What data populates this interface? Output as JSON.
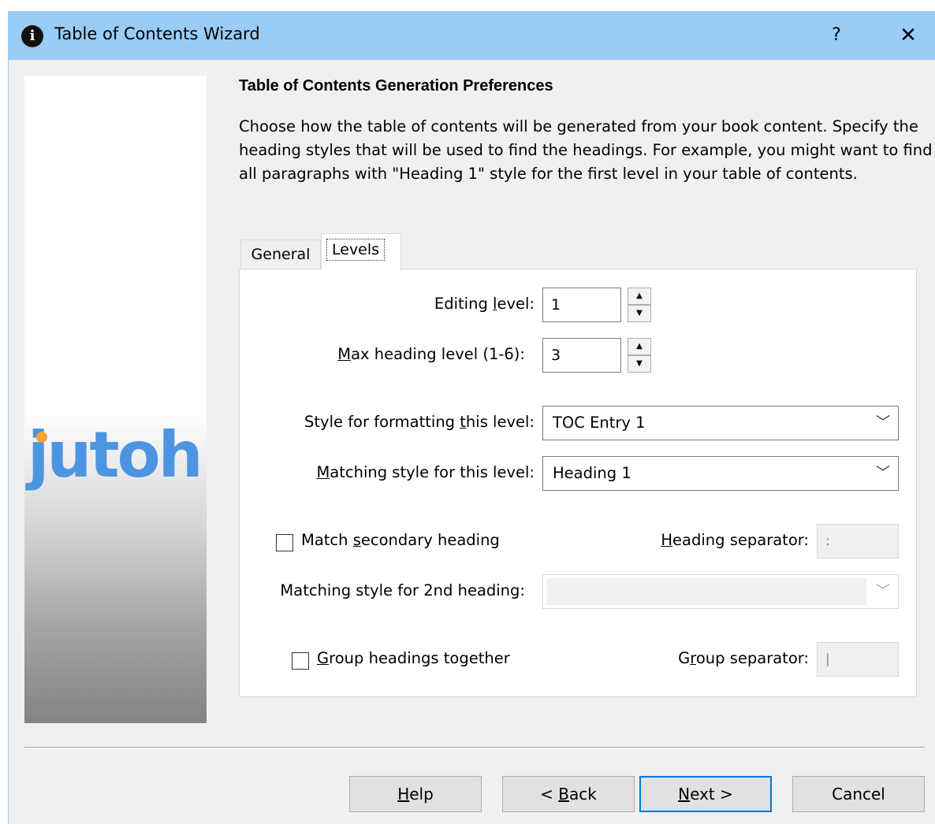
{
  "window": {
    "title": "Table of Contents Wizard",
    "help_label": "?",
    "close_label": "✕",
    "app_icon_glyph": "i"
  },
  "sidebar": {
    "logo_text": "jutoh"
  },
  "page": {
    "heading": "Table of Contents Generation Preferences",
    "description": "Choose how the table of contents will be generated from your book content. Specify the heading styles that will be used to find the headings. For example, you might want to find all paragraphs with \"Heading 1\" style for the first level in your table of contents."
  },
  "tabs": [
    {
      "label": "General",
      "active": false
    },
    {
      "label": "Levels",
      "active": true
    }
  ],
  "levels": {
    "editing_level": {
      "label_pre": "Editing ",
      "label_u": "l",
      "label_post": "evel:",
      "value": "1"
    },
    "max_heading_level": {
      "label_pre": "",
      "label_u": "M",
      "label_post": "ax heading level (1-6):",
      "value": "3"
    },
    "style_format": {
      "label_pre": "Style for formatting ",
      "label_u": "t",
      "label_post": "his level:",
      "value": "TOC Entry 1"
    },
    "matching_style": {
      "label_pre": "",
      "label_u": "M",
      "label_post": "atching style for this level:",
      "value": "Heading 1"
    },
    "match_secondary": {
      "label_pre": "Match ",
      "label_u": "s",
      "label_post": "econdary heading",
      "checked": false
    },
    "heading_separator": {
      "label_pre": "",
      "label_u": "H",
      "label_post": "eading separator:",
      "value": ":"
    },
    "matching_style_2nd": {
      "label": "Matching style for 2nd heading:",
      "value": ""
    },
    "group_headings": {
      "label_pre": "",
      "label_u": "G",
      "label_post": "roup headings together",
      "checked": false
    },
    "group_separator": {
      "label_pre": "G",
      "label_u": "r",
      "label_post": "oup separator:",
      "value": "|"
    }
  },
  "buttons": {
    "help": {
      "pre": "",
      "u": "H",
      "post": "elp"
    },
    "back": {
      "pre": "< ",
      "u": "B",
      "post": "ack"
    },
    "next": {
      "pre": "",
      "u": "N",
      "post": "ext >"
    },
    "cancel": {
      "label": "Cancel"
    }
  },
  "colors": {
    "titlebar": "#99ccf7",
    "logo": "#4d95e0",
    "logo_dot": "#f3a43b",
    "default_button_border": "#0078d7"
  },
  "icons": {
    "dropdown": "chevron-down-icon",
    "spin_up": "triangle-up-icon",
    "spin_down": "triangle-down-icon"
  }
}
